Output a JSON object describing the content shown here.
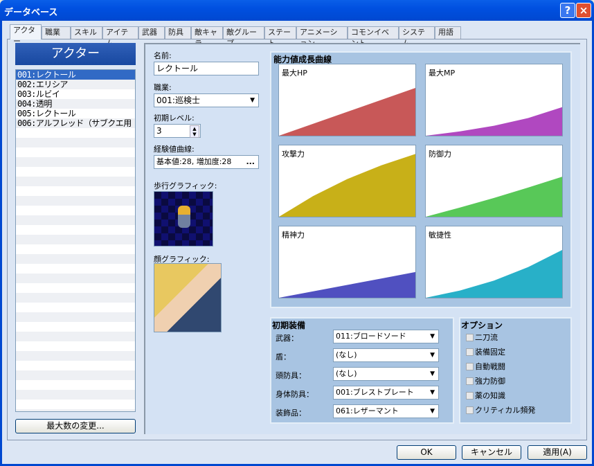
{
  "window": {
    "title": "データベース",
    "help_icon": "?",
    "close_icon": "×"
  },
  "tabs": [
    "アクター",
    "職業",
    "スキル",
    "アイテム",
    "武器",
    "防具",
    "敵キャラ",
    "敵グループ",
    "ステート",
    "アニメーション",
    "コモンイベント",
    "システム",
    "用語"
  ],
  "sidebar": {
    "header": "アクター",
    "items": [
      "001:レクトール",
      "002:エリシア",
      "003:ルビイ",
      "004:透明",
      "005:レクトール",
      "006:アルフレッド（サブクエ用"
    ],
    "selected": 0,
    "max_button": "最大数の変更..."
  },
  "form": {
    "name_label": "名前:",
    "name_value": "レクトール",
    "class_label": "職業:",
    "class_value": "001:巡検士",
    "level_label": "初期レベル:",
    "level_value": "3",
    "exp_label": "経験値曲線:",
    "exp_value": "基本値:28, 増加度:28",
    "exp_button": "...",
    "walk_label": "歩行グラフィック:",
    "face_label": "顔グラフィック:"
  },
  "growth": {
    "title": "能力値成長曲線",
    "charts": [
      {
        "label": "最大HP",
        "color": "#c85858",
        "curve": [
          0,
          0.25,
          0.5,
          0.75,
          1.0
        ],
        "level": 0.67
      },
      {
        "label": "最大MP",
        "color": "#b048c0",
        "curve": [
          0,
          0.15,
          0.35,
          0.62,
          1.0
        ],
        "level": 0.4
      },
      {
        "label": "攻撃力",
        "color": "#c8b018",
        "curve": [
          0,
          0.33,
          0.6,
          0.82,
          1.0
        ],
        "level": 0.88
      },
      {
        "label": "防御力",
        "color": "#58c858",
        "curve": [
          0,
          0.23,
          0.47,
          0.73,
          1.0
        ],
        "level": 0.56
      },
      {
        "label": "精神力",
        "color": "#5050c0",
        "curve": [
          0,
          0.25,
          0.5,
          0.75,
          1.0
        ],
        "level": 0.36
      },
      {
        "label": "敏捷性",
        "color": "#28b0c8",
        "curve": [
          0,
          0.15,
          0.36,
          0.64,
          1.0
        ],
        "level": 0.67
      }
    ]
  },
  "equipment": {
    "title": "初期装備",
    "rows": [
      {
        "label": "武器：",
        "value": "011:ブロードソード"
      },
      {
        "label": "盾：",
        "value": "(なし)"
      },
      {
        "label": "頭防具：",
        "value": "(なし)"
      },
      {
        "label": "身体防具：",
        "value": "001:ブレストプレート"
      },
      {
        "label": "装飾品：",
        "value": "061:レザーマント"
      }
    ]
  },
  "options": {
    "title": "オプション",
    "items": [
      {
        "label": "二刀流",
        "checked": false
      },
      {
        "label": "装備固定",
        "checked": false
      },
      {
        "label": "自動戦闘",
        "checked": false
      },
      {
        "label": "強力防御",
        "checked": false
      },
      {
        "label": "薬の知識",
        "checked": false
      },
      {
        "label": "クリティカル頻発",
        "checked": false
      }
    ]
  },
  "buttons": {
    "ok": "OK",
    "cancel": "キャンセル",
    "apply": "適用(A)"
  }
}
